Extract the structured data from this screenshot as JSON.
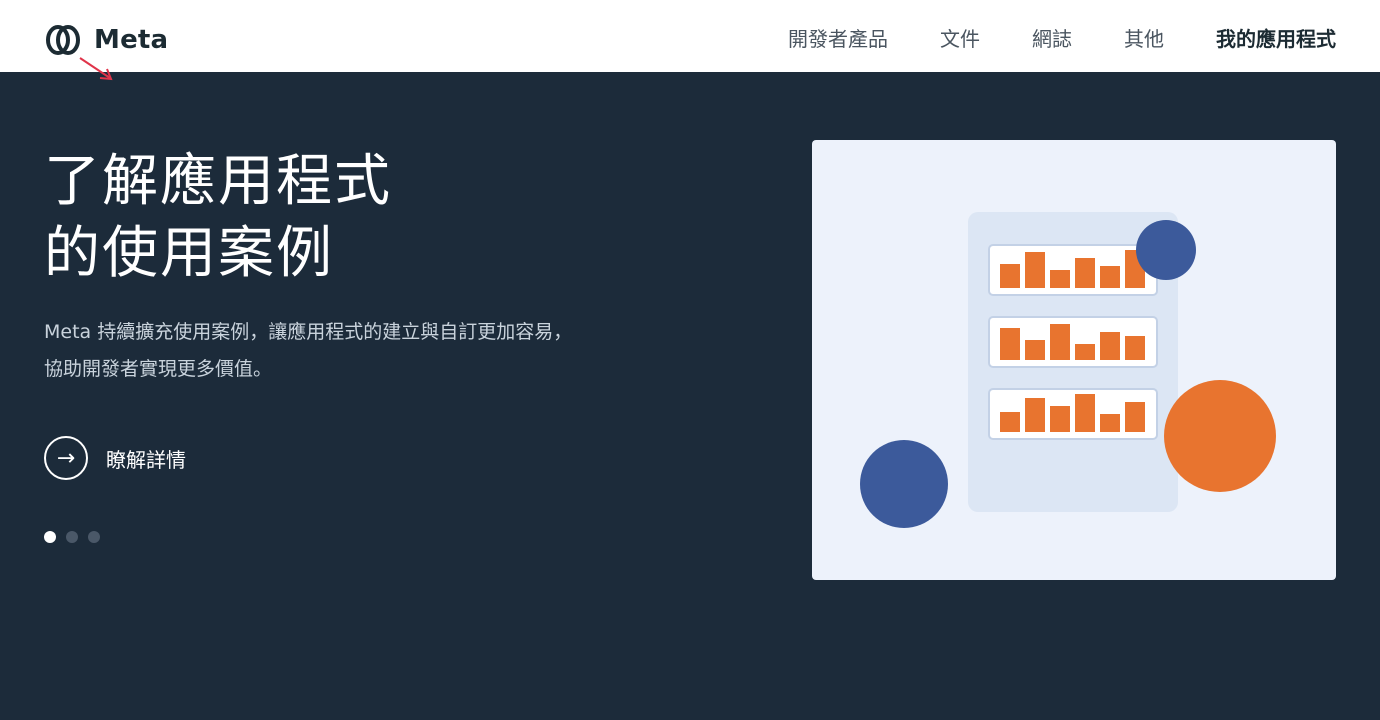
{
  "header": {
    "logo_text": "Meta",
    "nav": [
      {
        "label": "開發者產品",
        "active": false
      },
      {
        "label": "文件",
        "active": false
      },
      {
        "label": "網誌",
        "active": false
      },
      {
        "label": "其他",
        "active": false
      },
      {
        "label": "我的應用程式",
        "active": true
      }
    ]
  },
  "hero": {
    "title_line1": "了解應用程式",
    "title_line2": "的使用案例",
    "desc_line1": "Meta 持續擴充使用案例，讓應用程式的建立與自訂更加容易，",
    "desc_line2": "協助開發者實現更多價值。",
    "cta_icon": "arrow-right-icon",
    "cta_label": "瞭解詳情"
  },
  "carousel": {
    "slide_count": 3,
    "active_index": 0
  },
  "colors": {
    "background": "#1c2b3a",
    "accent_orange": "#e8742f",
    "accent_blue": "#3c5a9b",
    "panel": "#edf2fb",
    "card": "#dce6f4"
  }
}
